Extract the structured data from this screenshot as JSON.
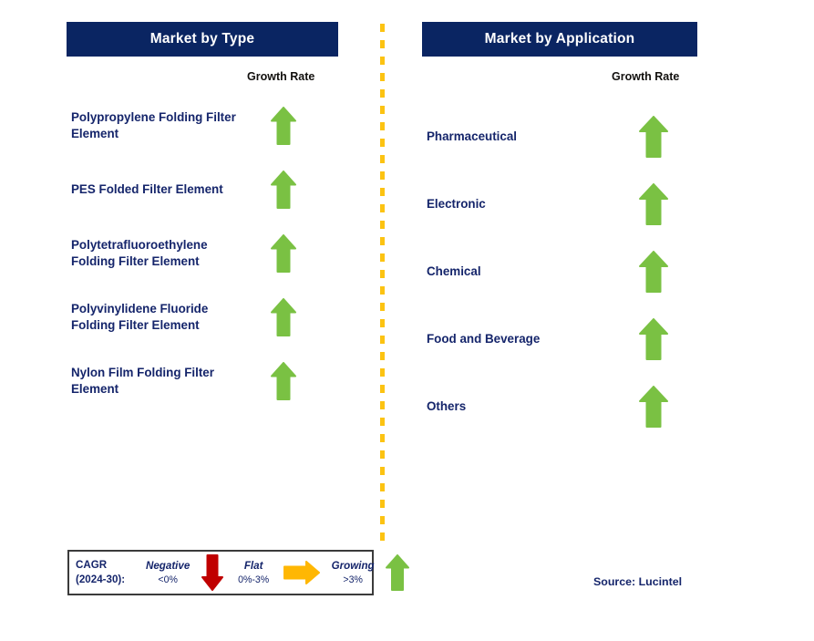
{
  "colors": {
    "header_bg": "#0a2562",
    "header_text": "#ffffff",
    "label_navy": "#15256b",
    "arrow_green": "#7ac143",
    "arrow_red": "#c00000",
    "arrow_orange": "#ffb703",
    "divider_amber": "#fcc312",
    "legend_border": "#3b3b3b",
    "page_bg": "#ffffff"
  },
  "columns": [
    {
      "id": "market-by-type",
      "header": "Market by Type",
      "growth_caption": "Growth Rate",
      "rows": [
        {
          "label": "Polypropylene Folding Filter Element",
          "growth": "growing",
          "icon": "arrow-up-icon"
        },
        {
          "label": "PES Folded Filter Element",
          "growth": "growing",
          "icon": "arrow-up-icon"
        },
        {
          "label": "Polytetrafluoroethylene Folding Filter Element",
          "growth": "growing",
          "icon": "arrow-up-icon"
        },
        {
          "label": "Polyvinylidene Fluoride Folding Filter Element",
          "growth": "growing",
          "icon": "arrow-up-icon"
        },
        {
          "label": "Nylon Film Folding Filter Element",
          "growth": "growing",
          "icon": "arrow-up-icon"
        }
      ]
    },
    {
      "id": "market-by-application",
      "header": "Market by Application",
      "growth_caption": "Growth Rate",
      "rows": [
        {
          "label": "Pharmaceutical",
          "growth": "growing",
          "icon": "arrow-up-icon"
        },
        {
          "label": "Electronic",
          "growth": "growing",
          "icon": "arrow-up-icon"
        },
        {
          "label": "Chemical",
          "growth": "growing",
          "icon": "arrow-up-icon"
        },
        {
          "label": "Food and Beverage",
          "growth": "growing",
          "icon": "arrow-up-icon"
        },
        {
          "label": "Others",
          "growth": "growing",
          "icon": "arrow-up-icon"
        }
      ]
    }
  ],
  "legend": {
    "title_line1": "CAGR",
    "title_line2": "(2024-30):",
    "items": [
      {
        "name": "Negative",
        "range": "<0%",
        "icon": "arrow-down-icon",
        "color": "#c00000"
      },
      {
        "name": "Flat",
        "range": "0%-3%",
        "icon": "arrow-right-icon",
        "color": "#ffb703"
      },
      {
        "name": "Growing",
        "range": ">3%",
        "icon": "arrow-up-icon",
        "color": "#7ac143"
      }
    ]
  },
  "source": "Source: Lucintel"
}
